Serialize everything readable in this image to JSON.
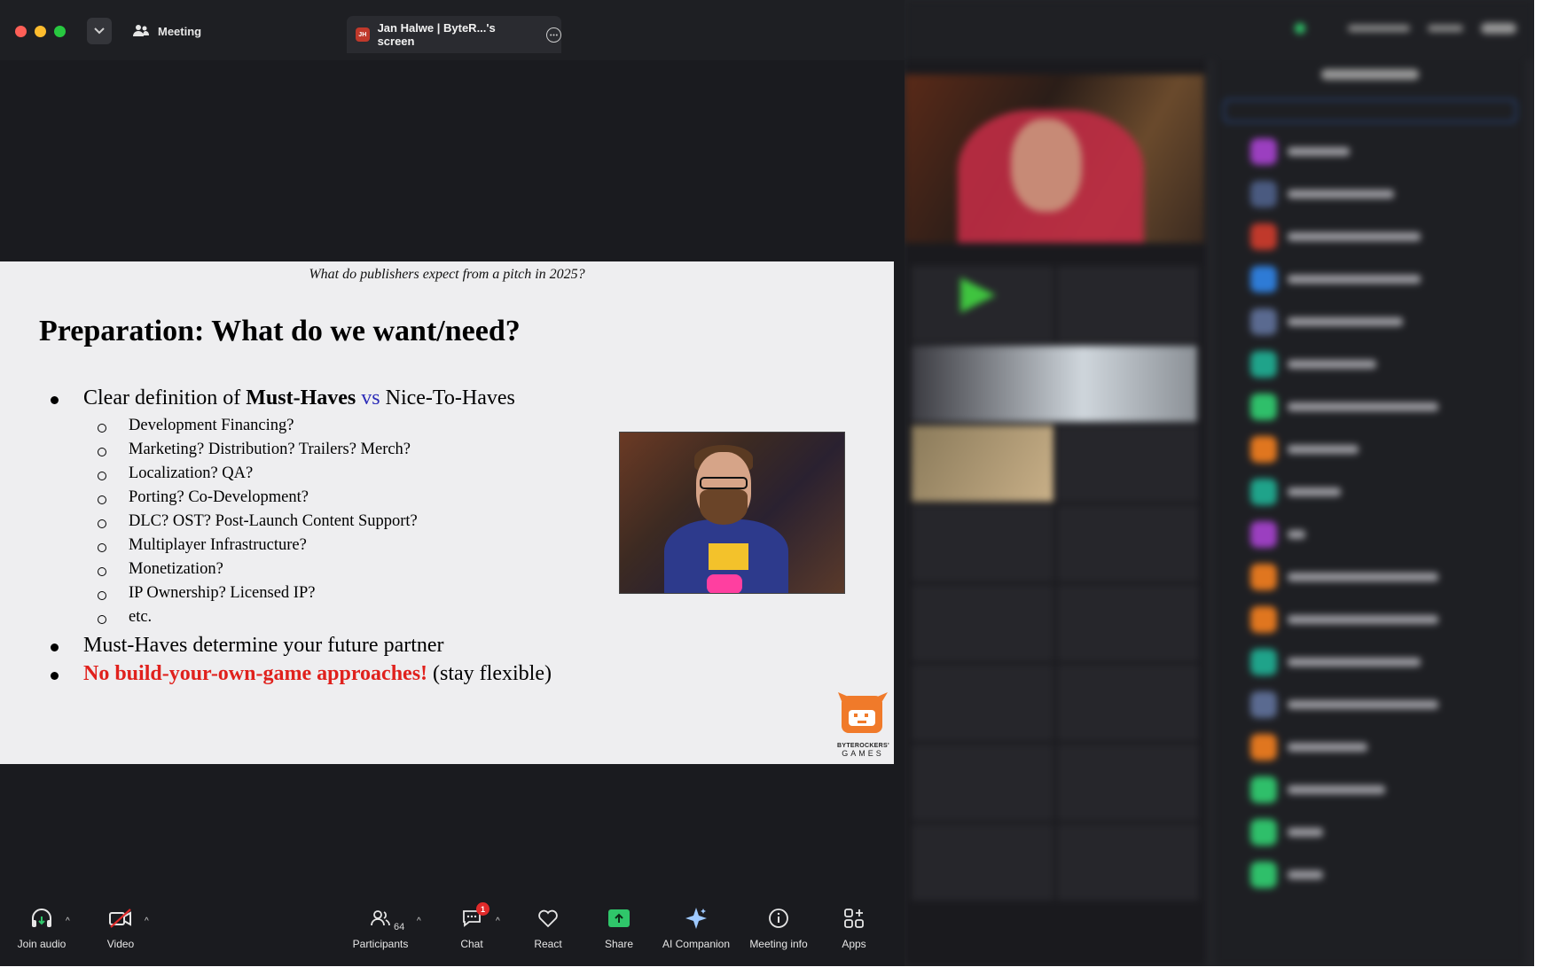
{
  "window": {
    "tab_meeting_label": "Meeting",
    "tab_share_initials": "JH",
    "tab_share_label": "Jan Halwe | ByteR...'s screen"
  },
  "slide": {
    "header": "What do publishers expect from a pitch in 2025?",
    "title": "Preparation: What do we want/need?",
    "bullet1": {
      "prefix": "Clear definition of ",
      "must_haves": "Must-Haves",
      "vs": " vs ",
      "nice_to_haves": "Nice-To-Haves"
    },
    "subitems": [
      "Development Financing?",
      "Marketing? Distribution? Trailers? Merch?",
      "Localization? QA?",
      "Porting? Co-Development?",
      "DLC? OST? Post-Launch Content Support?",
      "Multiplayer Infrastructure?",
      "Monetization?",
      "IP Ownership? Licensed IP?",
      "etc."
    ],
    "bullet2": "Must-Haves determine your future partner",
    "bullet3": {
      "red": "No build-your-own-game approaches!",
      "rest": " (stay flexible)"
    },
    "logo_line1": "BYTEROCKERS'",
    "logo_line2": "GAMES"
  },
  "toolbar": {
    "join_audio": "Join audio",
    "video": "Video",
    "participants": "Participants",
    "participants_count": "64",
    "chat": "Chat",
    "chat_badge": "1",
    "react": "React",
    "share": "Share",
    "ai_companion": "AI Companion",
    "meeting_info": "Meeting info",
    "apps": "Apps"
  },
  "colors": {
    "slide_bg": "#eeeef0",
    "emphasis_red": "#e0211d",
    "vs_blue": "#2b2bb8",
    "share_green": "#2fc66a",
    "window_bg": "#1a1b1f"
  }
}
